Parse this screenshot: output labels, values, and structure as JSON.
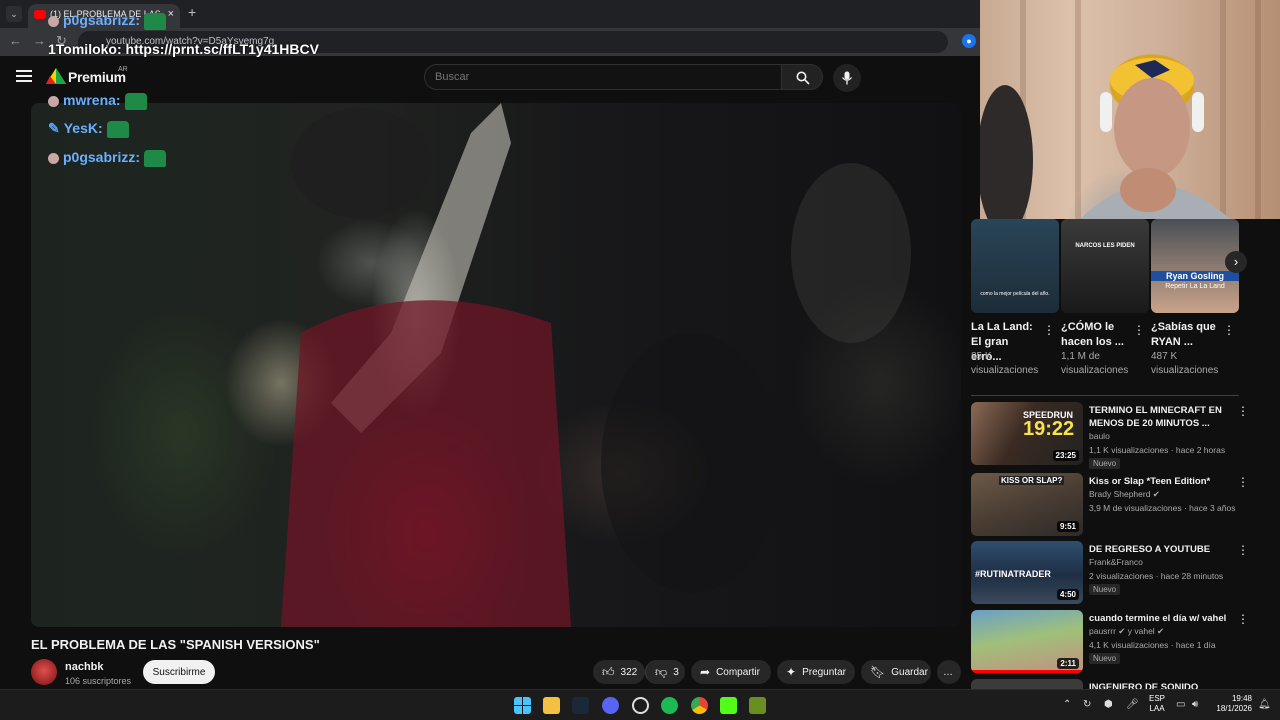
{
  "browser": {
    "tab_title": "(1) EL PROBLEMA DE LAS \"SPA",
    "tab_close": "×",
    "new_tab": "+",
    "tab_list": "⌄",
    "url": "youtube.com/watch?v=D5aYsvemg7g",
    "nav_back": "←",
    "nav_forward": "→",
    "nav_reload": "↻"
  },
  "masthead": {
    "brand": "Premium",
    "country": "AR",
    "search_placeholder": "Buscar"
  },
  "chat": [
    {
      "name": "p0gsabrizz:",
      "emote": true
    },
    {
      "name": "1Tomiloko:",
      "text": "https://prnt.sc/ffLT1y41HBCV"
    },
    {
      "name": "mwrena:",
      "emote": true
    },
    {
      "name": "YesK:",
      "emote": true
    },
    {
      "name": "p0gsabrizz:",
      "emote": true
    }
  ],
  "video": {
    "title": "EL PROBLEMA DE LAS \"SPANISH VERSIONS\"",
    "channel": "nachbk",
    "subscribers": "106 suscriptores",
    "subscribe_label": "Suscribirme",
    "likes": "322",
    "dislikes": "3",
    "share_label": "Compartir",
    "ask_label": "Preguntar",
    "save_label": "Guardar",
    "more": "…"
  },
  "shorts": [
    {
      "title": "La La Land: El gran erro...",
      "views": "85 K visualizaciones",
      "caption": "como la mejor película del año."
    },
    {
      "title": "¿CÓMO le hacen los ...",
      "views": "1,1 M de visualizaciones",
      "caption": "NARCOS LES PIDEN"
    },
    {
      "title": "¿Sabías que RYAN ...",
      "views": "487 K visualizaciones",
      "caption_top": "Ryan Gosling",
      "caption_bottom": "Repetir La La Land"
    }
  ],
  "recommendations": [
    {
      "title": "TERMINO EL MINECRAFT EN MENOS DE 20 MINUTOS ...",
      "channel": "baulo",
      "meta": "1,1 K visualizaciones · hace 2 horas",
      "badge": "Nuevo",
      "duration": "23:25",
      "overlay_top": "SPEEDRUN",
      "overlay_big": "19:22",
      "progress": 0
    },
    {
      "title": "Kiss or Slap *Teen Edition*",
      "channel": "Brady Shepherd ✔",
      "meta": "3,9 M de visualizaciones · hace 3 años",
      "badge": "",
      "duration": "9:51",
      "overlay_top": "KISS OR SLAP?",
      "overlay_big": "",
      "progress": 0
    },
    {
      "title": "DE REGRESO A YOUTUBE",
      "channel": "Frank&Franco",
      "meta": "2 visualizaciones · hace 28 minutos",
      "badge": "Nuevo",
      "duration": "4:50",
      "overlay_top": "#RUTINATRADER",
      "overlay_big": "",
      "progress": 0
    },
    {
      "title": "cuando termine el día w/ vahel",
      "channel": "pausrrr ✔ y vahel ✔",
      "meta": "4,1 K visualizaciones · hace 1 día",
      "badge": "Nuevo",
      "duration": "2:11",
      "overlay_top": "",
      "overlay_big": "",
      "progress": 1.0
    },
    {
      "title": "INGENIERO DE SONIDO",
      "channel": "",
      "meta": "",
      "badge": "",
      "duration": "",
      "overlay_top": "",
      "overlay_big": "",
      "progress": 0
    }
  ],
  "taskbar": {
    "lang_top": "ESP",
    "lang_bottom": "LAA",
    "time": "19:48",
    "date": "18/1/2026"
  }
}
